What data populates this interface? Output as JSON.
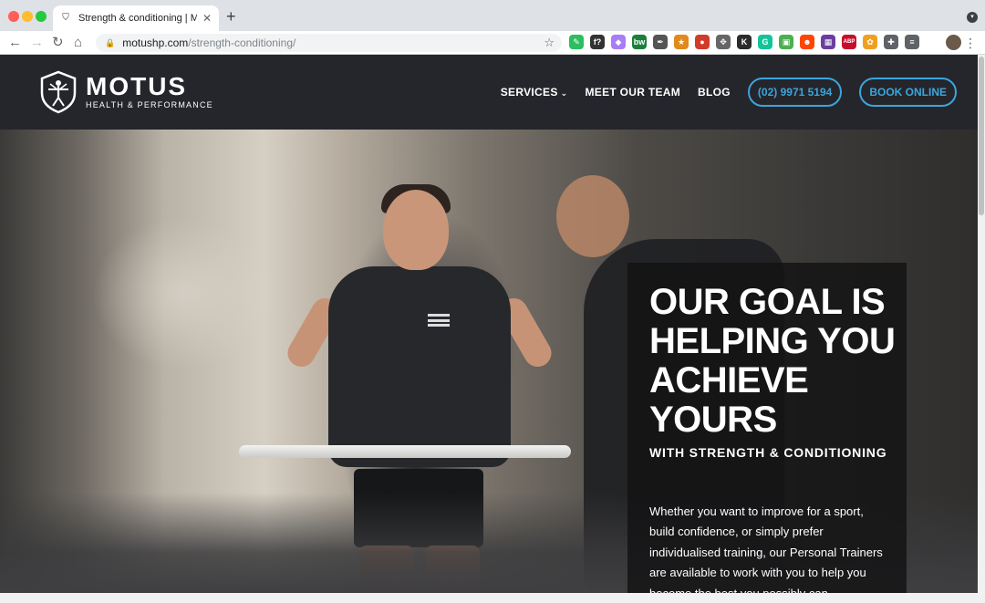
{
  "browser": {
    "tab_title": "Strength & conditioning | Motus",
    "url_host": "motushp.com",
    "url_path": "/strength-conditioning/",
    "extensions": [
      {
        "name": "evernote-icon",
        "glyph": "✎",
        "color": "#2dbe60"
      },
      {
        "name": "formula-icon",
        "glyph": "f?",
        "color": "#333333"
      },
      {
        "name": "puzzle-purple-icon",
        "glyph": "◆",
        "color": "#a87df5"
      },
      {
        "name": "bw-icon",
        "glyph": "bw",
        "color": "#1a7f3a"
      },
      {
        "name": "eyedropper-icon",
        "glyph": "✒",
        "color": "#555555"
      },
      {
        "name": "badge-icon",
        "glyph": "★",
        "color": "#e08a1e"
      },
      {
        "name": "red-badge-icon",
        "glyph": "●",
        "color": "#d23b2a"
      },
      {
        "name": "move-icon",
        "glyph": "✥",
        "color": "#666666"
      },
      {
        "name": "k-icon",
        "glyph": "K",
        "color": "#2b2b2b"
      },
      {
        "name": "grammarly-icon",
        "glyph": "G",
        "color": "#15c39a"
      },
      {
        "name": "inbox-icon",
        "glyph": "▣",
        "color": "#4caf50"
      },
      {
        "name": "reddit-icon",
        "glyph": "☻",
        "color": "#ff4500"
      },
      {
        "name": "frame-icon",
        "glyph": "▦",
        "color": "#6b3fa0"
      },
      {
        "name": "abp-icon",
        "glyph": "ABP",
        "color": "#c70d2c"
      },
      {
        "name": "flower-icon",
        "glyph": "✿",
        "color": "#f0a020"
      },
      {
        "name": "extensions-icon",
        "glyph": "✚",
        "color": "#5f6368"
      },
      {
        "name": "playlist-icon",
        "glyph": "≡",
        "color": "#5f6368"
      }
    ]
  },
  "site": {
    "brand": {
      "name": "MOTUS",
      "tagline": "HEALTH & PERFORMANCE"
    },
    "nav": {
      "services": "SERVICES",
      "team": "MEET OUR TEAM",
      "blog": "BLOG",
      "phone": "(02) 9971 5194",
      "book": "BOOK ONLINE"
    },
    "hero": {
      "title": "OUR GOAL IS HELPING YOU ACHIEVE YOURS",
      "subtitle": "WITH STRENGTH & CONDITIONING",
      "body": "Whether you want to improve for a sport, build confidence, or simply prefer individualised training, our Personal Trainers are available to work with you to help you become the best you possibly can."
    },
    "colors": {
      "header_bg": "#25252c",
      "accent": "#3aa6db"
    }
  }
}
